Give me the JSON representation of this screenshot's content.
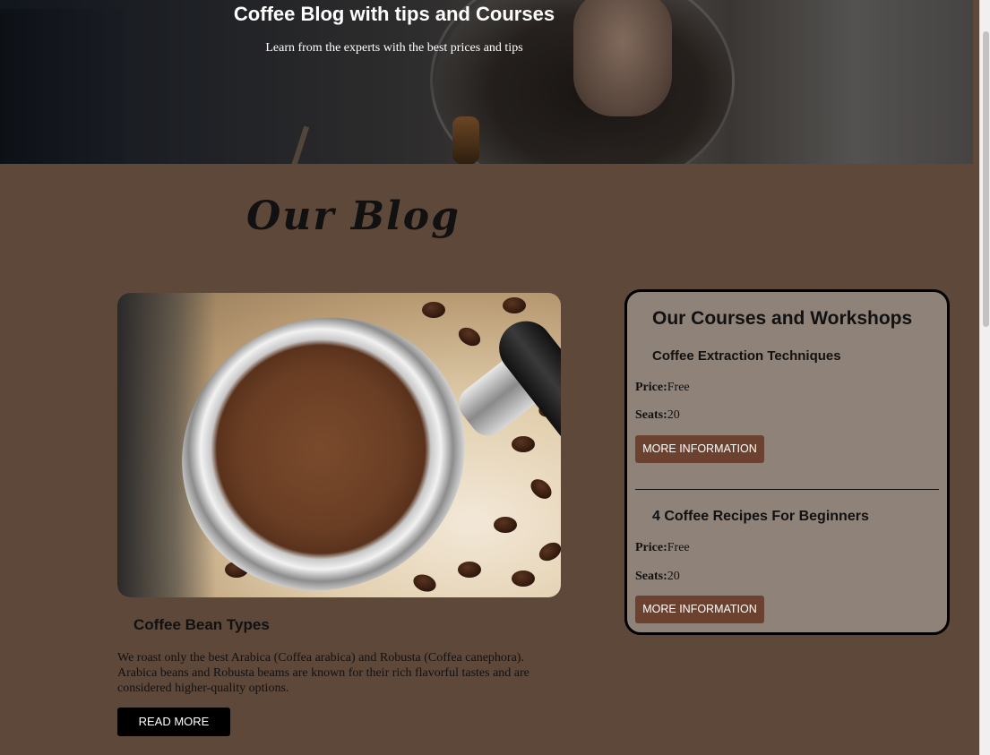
{
  "hero": {
    "title": "Coffee Blog with tips and Courses",
    "subtitle": "Learn from the experts with the best prices and tips"
  },
  "blog": {
    "heading": "Our Blog",
    "card": {
      "title": "Coffee Bean Types",
      "text": "We roast only the best Arabica (Coffea arabica) and Robusta (Coffea canephora). Arabica beans and Robusta beams are known for their rich flavorful tastes and are considered higher-quality options.",
      "button": "READ MORE"
    }
  },
  "courses": {
    "title": "Our Courses and Workshops",
    "items": [
      {
        "name": "Coffee Extraction Techniques",
        "price_label": "Price:",
        "price": "Free",
        "seats_label": "Seats:",
        "seats": "20",
        "button": "MORE INFORMATION"
      },
      {
        "name": "4 Coffee Recipes For Beginners",
        "price_label": "Price:",
        "price": "Free",
        "seats_label": "Seats:",
        "seats": "20",
        "button": "MORE INFORMATION"
      }
    ]
  },
  "colors": {
    "page_background": "#5e483a",
    "course_panel": "#8f8279",
    "more_info_button": "#6b4230",
    "read_more_button": "#000000"
  }
}
